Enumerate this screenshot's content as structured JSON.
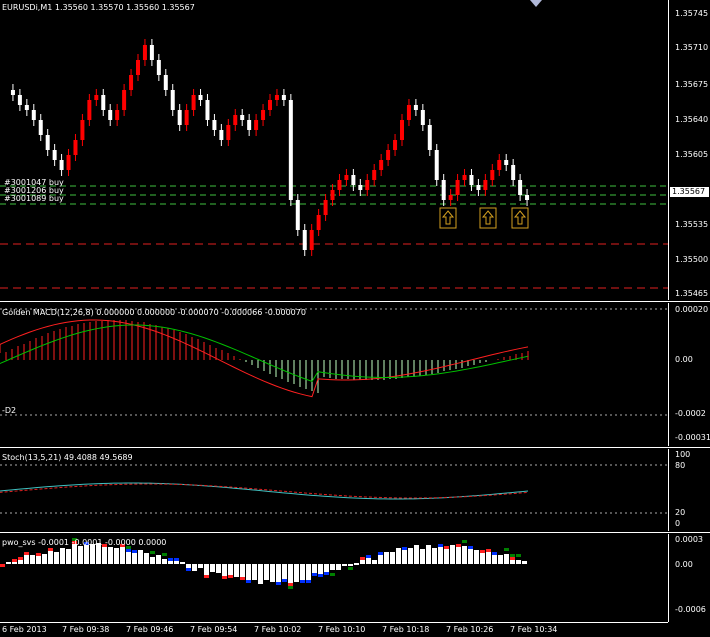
{
  "main": {
    "symbol_label": "EURUSDi,M1  1.35560 1.35570 1.35560 1.35567",
    "price_axis": [
      "1.35745",
      "1.35710",
      "1.35675",
      "1.35640",
      "1.35605",
      "1.35570",
      "1.35535",
      "1.35500",
      "1.35465"
    ],
    "current_price": "1.35567",
    "orders": [
      "#3001047 buy",
      "#3001206 buy",
      "#3001089 buy"
    ]
  },
  "macd": {
    "label": "Golden MACD(12,26,8) 0.000000 0.000000 -0.000070 -0.000066 -0.000070",
    "axis": [
      "0.00020",
      "0.00",
      "-0.0002",
      "-0.00031"
    ],
    "side_label": "-D2"
  },
  "stoch": {
    "label": "Stoch(13,5,21) 49.4088 49.5689",
    "axis": [
      "100",
      "80",
      "20",
      "0"
    ]
  },
  "pwo": {
    "label": "pwo_svs -0.0001 -0.0001 -0.0000 0.0000",
    "axis": [
      "0.0003",
      "0.00",
      "-0.0006"
    ]
  },
  "time_axis": [
    "6 Feb 2013",
    "7 Feb 09:38",
    "7 Feb 09:46",
    "7 Feb 09:54",
    "7 Feb 10:02",
    "7 Feb 10:10",
    "7 Feb 10:18",
    "7 Feb 10:26",
    "7 Feb 10:34"
  ],
  "colors": {
    "bull": "#ff0000",
    "bear": "#ffffff",
    "signal": "#00c000",
    "macd_line": "#ff2020",
    "arrow": "#d4a020"
  },
  "icons": {
    "buy_arrow": "up-arrow-icon",
    "scroll_marker": "triangle-down-icon"
  }
}
